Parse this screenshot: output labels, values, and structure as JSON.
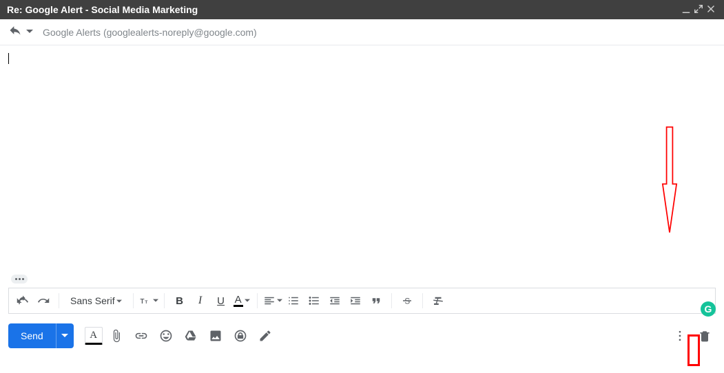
{
  "titlebar": {
    "title": "Re: Google Alert - Social Media Marketing"
  },
  "header": {
    "recipient": "Google Alerts (googlealerts-noreply@google.com)"
  },
  "format": {
    "font_family": "Sans Serif",
    "size_label": "T",
    "bold": "B",
    "italic": "I",
    "underline": "U",
    "color": "A",
    "quote": "❞",
    "strike": "S"
  },
  "actions": {
    "send": "Send",
    "format_toggle": "A",
    "grammarly": "G"
  }
}
